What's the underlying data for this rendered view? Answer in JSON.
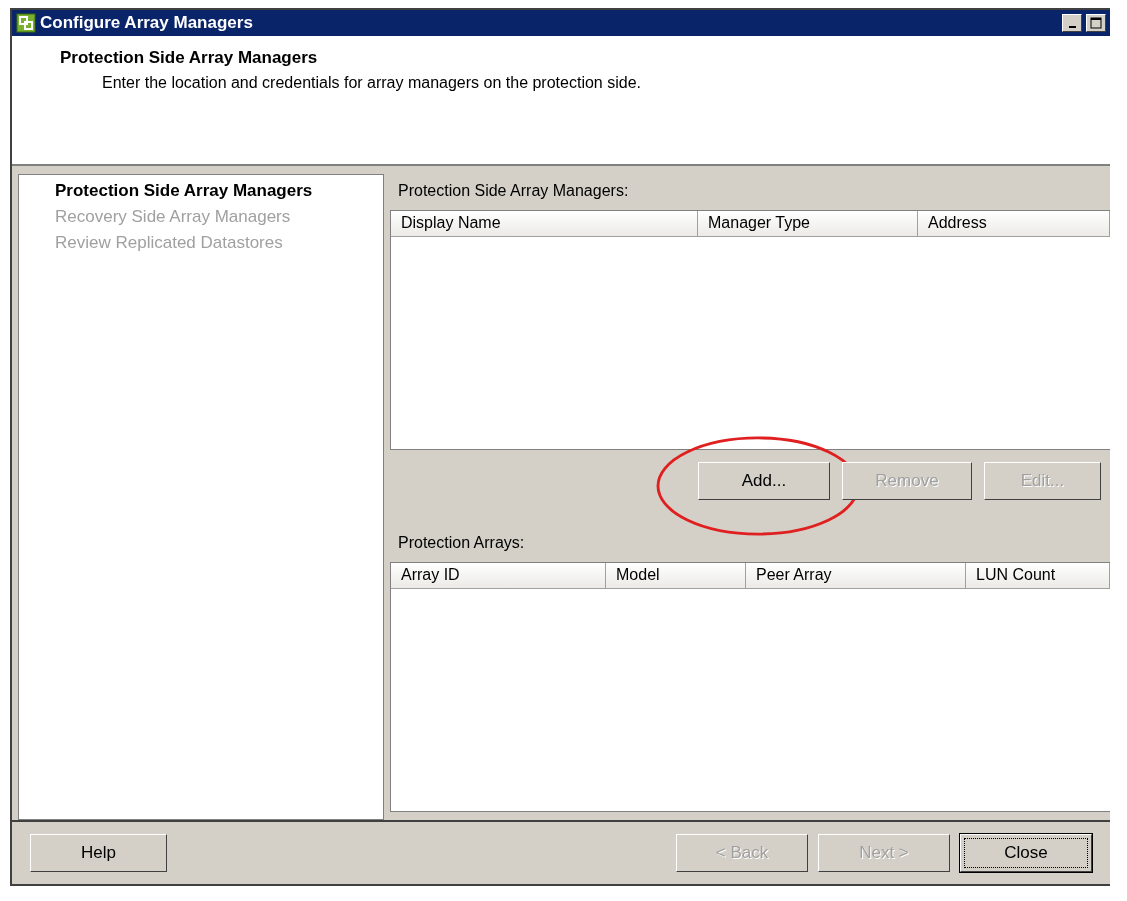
{
  "window": {
    "title": "Configure Array Managers"
  },
  "header": {
    "title": "Protection Side Array Managers",
    "description": "Enter the location and credentials for array managers on the protection side."
  },
  "steps": [
    {
      "label": "Protection Side Array Managers",
      "selected": true,
      "disabled": false
    },
    {
      "label": "Recovery Side Array Managers",
      "selected": false,
      "disabled": true
    },
    {
      "label": "Review Replicated Datastores",
      "selected": false,
      "disabled": true
    }
  ],
  "managers": {
    "label": "Protection Side Array Managers:",
    "columns": [
      "Display Name",
      "Manager Type",
      "Address"
    ]
  },
  "manager_buttons": [
    {
      "label": "Add...",
      "disabled": false,
      "highlighted": true
    },
    {
      "label": "Remove",
      "disabled": true,
      "highlighted": false
    },
    {
      "label": "Edit...",
      "disabled": true,
      "highlighted": false
    }
  ],
  "arrays": {
    "label": "Protection Arrays:",
    "columns": [
      "Array ID",
      "Model",
      "Peer Array",
      "LUN Count"
    ]
  },
  "footer": {
    "help": "Help",
    "buttons": [
      {
        "label": "< Back",
        "disabled": true,
        "default": false
      },
      {
        "label": "Next >",
        "disabled": true,
        "default": false
      },
      {
        "label": "Close",
        "disabled": false,
        "default": true
      }
    ]
  }
}
